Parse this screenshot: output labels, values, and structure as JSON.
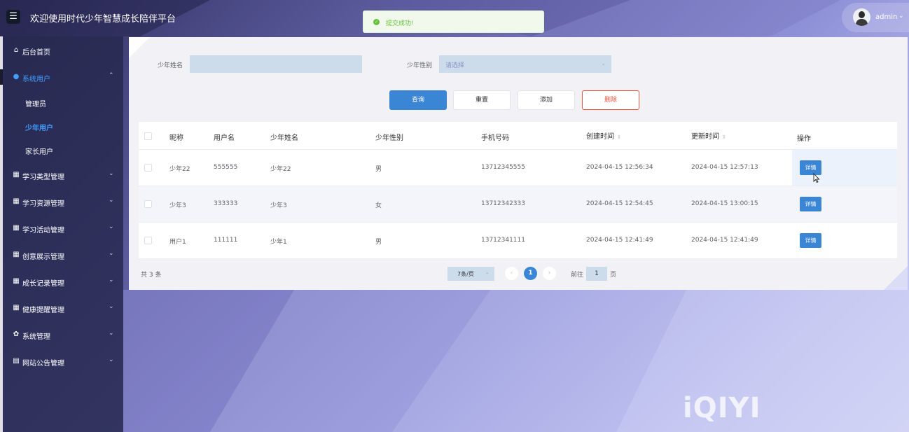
{
  "header": {
    "menu_icon": "☰",
    "title": "欢迎使用时代少年智慧成长陪伴平台",
    "toast": "提交成功!",
    "toast_icon": "✓",
    "user": "admin",
    "user_caret": "⌄"
  },
  "sidebar": {
    "items": [
      {
        "label": "后台首页",
        "icon": "⌂"
      },
      {
        "label": "系统用户",
        "icon": "●",
        "chevron": "⌃"
      },
      {
        "label": "管理员"
      },
      {
        "label": "少年用户"
      },
      {
        "label": "家长用户"
      },
      {
        "label": "学习类型管理",
        "icon": "▦",
        "chevron": "⌄"
      },
      {
        "label": "学习资源管理",
        "icon": "▦",
        "chevron": "⌄"
      },
      {
        "label": "学习活动管理",
        "icon": "▦",
        "chevron": "⌄"
      },
      {
        "label": "创意展示管理",
        "icon": "▦",
        "chevron": "⌄"
      },
      {
        "label": "成长记录管理",
        "icon": "▦",
        "chevron": "⌄"
      },
      {
        "label": "健康提醒管理",
        "icon": "▦",
        "chevron": "⌄"
      },
      {
        "label": "系统管理",
        "icon": "✿",
        "chevron": "⌄"
      },
      {
        "label": "网站公告管理",
        "icon": "▤",
        "chevron": "⌄"
      }
    ]
  },
  "filters": {
    "name_label": "少年姓名",
    "name_value": "",
    "gender_label": "少年性别",
    "gender_placeholder": "请选择"
  },
  "buttons": {
    "query": "查询",
    "reset": "重置",
    "add": "添加",
    "delete": "删除"
  },
  "table": {
    "headers": [
      "昵称",
      "用户名",
      "少年姓名",
      "少年性别",
      "手机号码",
      "创建时间",
      "更新时间",
      "操作"
    ],
    "sort_icon": "⇕",
    "rows": [
      {
        "nickname": "少年22",
        "username": "555555",
        "name": "少年22",
        "gender": "男",
        "phone": "13712345555",
        "created": "2024-04-15 12:56:34",
        "updated": "2024-04-15 12:57:13",
        "action": "详情"
      },
      {
        "nickname": "少年3",
        "username": "333333",
        "name": "少年3",
        "gender": "女",
        "phone": "13712342333",
        "created": "2024-04-15 12:54:45",
        "updated": "2024-04-15 13:00:15",
        "action": "详情"
      },
      {
        "nickname": "用户1",
        "username": "111111",
        "name": "少年1",
        "gender": "男",
        "phone": "13712341111",
        "created": "2024-04-15 12:41:49",
        "updated": "2024-04-15 12:41:49",
        "action": "详情"
      }
    ]
  },
  "pagination": {
    "total": "共 3 条",
    "page_size": "7条/页",
    "prev": "‹",
    "current": "1",
    "next": "›",
    "goto_label": "前往",
    "goto_value": "1",
    "page_label": "页"
  },
  "watermark": "iQIYI",
  "colors": {
    "primary": "#3a86d4",
    "active_nav": "#409eff",
    "danger": "#e4553d",
    "success": "#67c23a"
  }
}
